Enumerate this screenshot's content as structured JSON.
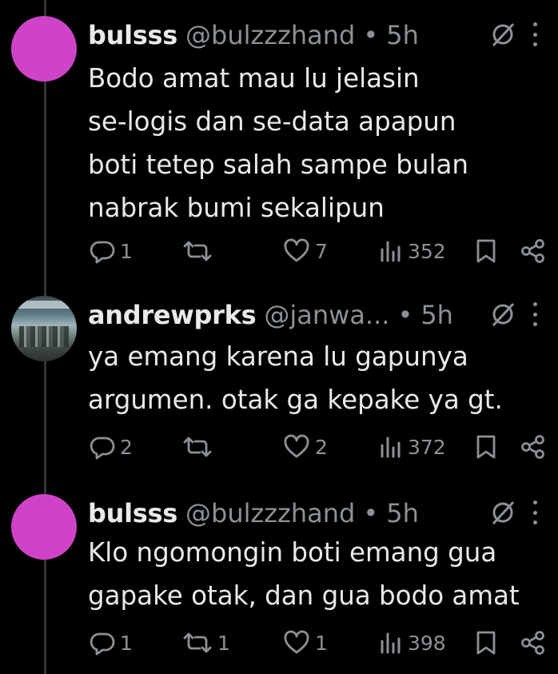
{
  "tweets": [
    {
      "avatar": "avatar-magenta",
      "name": "bulsss",
      "handle": "@bulzzzhand",
      "dot": "•",
      "time": "5h",
      "lines": [
        "Bodo amat mau lu jelasin",
        "se-logis dan se-data apapun",
        "boti tetep salah sampe bulan",
        "nabrak bumi sekalipun"
      ],
      "replies": "1",
      "reposts": "",
      "likes": "7",
      "views": "352"
    },
    {
      "avatar": "avatar-photo",
      "name": "andrewprks",
      "handle": "@janwa...",
      "dot": "•",
      "time": "5h",
      "lines": [
        "ya emang karena lu gapunya",
        "argumen. otak ga kepake ya gt."
      ],
      "replies": "2",
      "reposts": "",
      "likes": "2",
      "views": "372"
    },
    {
      "avatar": "avatar-magenta",
      "name": "bulsss",
      "handle": "@bulzzzhand",
      "dot": "•",
      "time": "5h",
      "lines": [
        "Klo ngomongin boti emang gua",
        "gapake otak, dan gua bodo amat"
      ],
      "replies": "1",
      "reposts": "1",
      "likes": "1",
      "views": "398"
    }
  ],
  "icons": {
    "reply": "reply-icon",
    "repost": "repost-icon",
    "like": "like-icon",
    "views": "views-icon",
    "bookmark": "bookmark-icon",
    "share": "share-icon",
    "mute": "mute-icon",
    "more": "more-icon"
  },
  "colors": {
    "background": "#000000",
    "text": "#e7e9ea",
    "secondary": "#8b9196",
    "avatar": "#cf44c6",
    "thread_line": "#333639"
  }
}
